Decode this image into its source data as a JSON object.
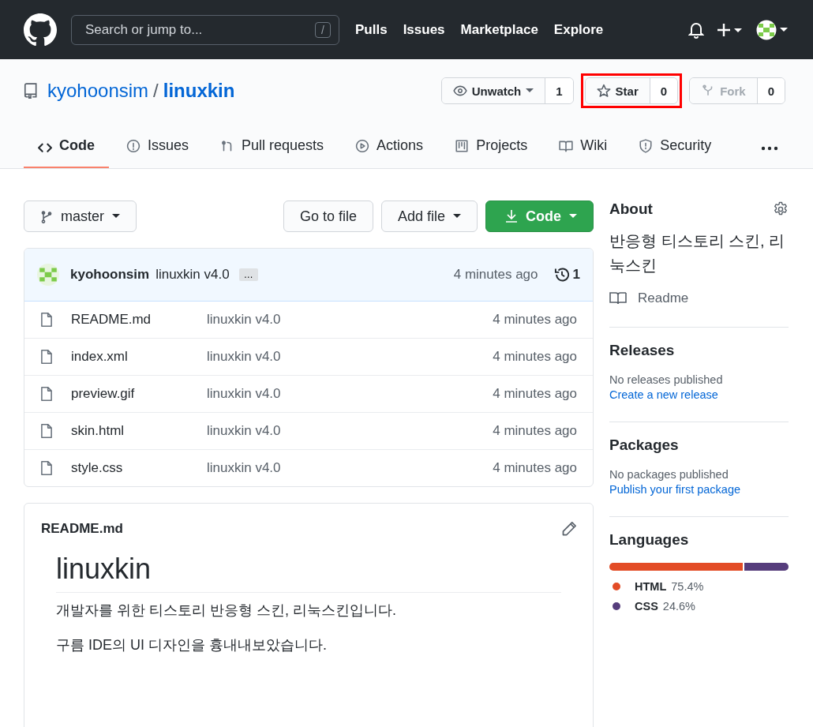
{
  "header": {
    "search": {
      "placeholder": "Search or jump to...",
      "shortcut": "/"
    },
    "nav": [
      "Pulls",
      "Issues",
      "Marketplace",
      "Explore"
    ]
  },
  "repo": {
    "owner": "kyohoonsim",
    "separator": "/",
    "name": "linuxkin",
    "actions": [
      {
        "kind": "watch",
        "label": "Unwatch",
        "count": "1",
        "highlighted": false,
        "disabled": false
      },
      {
        "kind": "star",
        "label": "Star",
        "count": "0",
        "highlighted": true,
        "disabled": false
      },
      {
        "kind": "fork",
        "label": "Fork",
        "count": "0",
        "highlighted": false,
        "disabled": true
      }
    ]
  },
  "tabs": [
    {
      "kind": "code",
      "label": "Code",
      "selected": true
    },
    {
      "kind": "issues",
      "label": "Issues",
      "selected": false
    },
    {
      "kind": "pulls",
      "label": "Pull requests",
      "selected": false
    },
    {
      "kind": "actions",
      "label": "Actions",
      "selected": false
    },
    {
      "kind": "projects",
      "label": "Projects",
      "selected": false
    },
    {
      "kind": "wiki",
      "label": "Wiki",
      "selected": false
    },
    {
      "kind": "security",
      "label": "Security",
      "selected": false
    }
  ],
  "toolbar": {
    "branch": "master",
    "go_to_file": "Go to file",
    "add_file": "Add file",
    "code": "Code"
  },
  "commit": {
    "author": "kyohoonsim",
    "message": "linuxkin v4.0",
    "ellipsis": "…",
    "time": "4 minutes ago",
    "count": "1"
  },
  "files": [
    {
      "name": "README.md",
      "message": "linuxkin v4.0",
      "time": "4 minutes ago"
    },
    {
      "name": "index.xml",
      "message": "linuxkin v4.0",
      "time": "4 minutes ago"
    },
    {
      "name": "preview.gif",
      "message": "linuxkin v4.0",
      "time": "4 minutes ago"
    },
    {
      "name": "skin.html",
      "message": "linuxkin v4.0",
      "time": "4 minutes ago"
    },
    {
      "name": "style.css",
      "message": "linuxkin v4.0",
      "time": "4 minutes ago"
    }
  ],
  "readme": {
    "filename": "README.md",
    "title": "linuxkin",
    "paragraphs": [
      "개발자를 위한 티스토리 반응형 스킨, 리눅스킨입니다.",
      "구름 IDE의 UI 디자인을 흉내내보았습니다."
    ]
  },
  "sidebar": {
    "about": {
      "title": "About",
      "description": "반응형 티스토리 스킨, 리눅스킨",
      "readme": "Readme"
    },
    "releases": {
      "title": "Releases",
      "note": "No releases published",
      "link": "Create a new release"
    },
    "packages": {
      "title": "Packages",
      "note": "No packages published",
      "link": "Publish your first package"
    },
    "languages": {
      "title": "Languages",
      "items": [
        {
          "name": "HTML",
          "percent": "75.4%",
          "level": 0.754,
          "color": "#e34c26"
        },
        {
          "name": "CSS",
          "percent": "24.6%",
          "level": 0.246,
          "color": "#563d7c"
        }
      ]
    }
  }
}
